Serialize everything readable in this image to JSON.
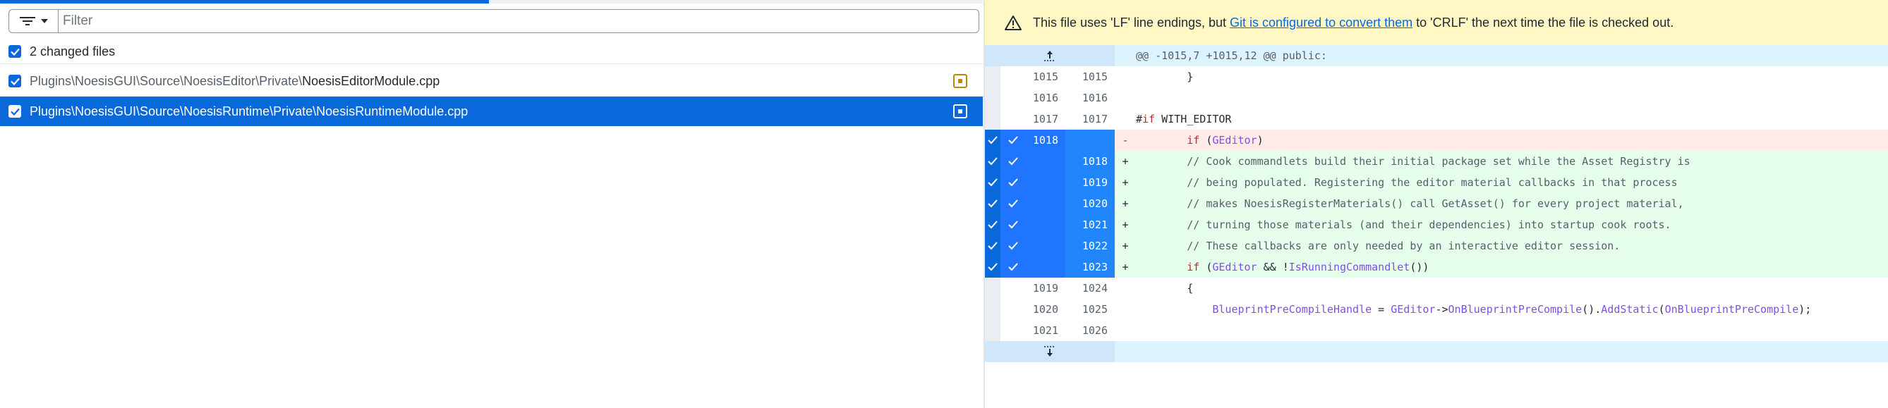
{
  "sidebar": {
    "filter": {
      "placeholder": "Filter",
      "value": ""
    },
    "changed_files_label": "2 changed files",
    "files": [
      {
        "dir": "Plugins\\NoesisGUI\\Source\\NoesisEditor\\Private\\",
        "name": "NoesisEditorModule.cpp",
        "status": "modified",
        "selected": false
      },
      {
        "dir": "Plugins\\NoesisGUI\\Source\\NoesisRuntime\\Private\\",
        "name": "NoesisRuntimeModule.cpp",
        "status": "modified",
        "selected": true
      }
    ]
  },
  "banner": {
    "text_before": "This file uses 'LF' line endings, but",
    "link_text": "Git is configured to convert them",
    "text_after": "to 'CRLF' the next time the file is checked out."
  },
  "diff": {
    "hunk_header": "@@ -1015,7 +1015,12 @@ public:",
    "lines": [
      {
        "type": "context",
        "old": "1015",
        "new": "1015",
        "sign": "",
        "code": "        }"
      },
      {
        "type": "context",
        "old": "1016",
        "new": "1016",
        "sign": "",
        "code": ""
      },
      {
        "type": "context",
        "old": "1017",
        "new": "1017",
        "sign": "",
        "code": "#if WITH_EDITOR"
      },
      {
        "type": "del",
        "old": "1018",
        "new": "",
        "sign": "-",
        "code": "        if (GEditor)"
      },
      {
        "type": "add",
        "old": "",
        "new": "1018",
        "sign": "+",
        "code": "        // Cook commandlets build their initial package set while the Asset Registry is"
      },
      {
        "type": "add",
        "old": "",
        "new": "1019",
        "sign": "+",
        "code": "        // being populated. Registering the editor material callbacks in that process"
      },
      {
        "type": "add",
        "old": "",
        "new": "1020",
        "sign": "+",
        "code": "        // makes NoesisRegisterMaterials() call GetAsset() for every project material,"
      },
      {
        "type": "add",
        "old": "",
        "new": "1021",
        "sign": "+",
        "code": "        // turning those materials (and their dependencies) into startup cook roots."
      },
      {
        "type": "add",
        "old": "",
        "new": "1022",
        "sign": "+",
        "code": "        // These callbacks are only needed by an interactive editor session."
      },
      {
        "type": "add",
        "old": "",
        "new": "1023",
        "sign": "+",
        "code": "        if (GEditor && !IsRunningCommandlet())"
      },
      {
        "type": "context",
        "old": "1019",
        "new": "1024",
        "sign": "",
        "code": "        {"
      },
      {
        "type": "context",
        "old": "1020",
        "new": "1025",
        "sign": "",
        "code": "            BlueprintPreCompileHandle = GEditor->OnBlueprintPreCompile().AddStatic(OnBlueprintPreCompile);"
      },
      {
        "type": "context",
        "old": "1021",
        "new": "1026",
        "sign": "",
        "code": ""
      }
    ]
  },
  "colors": {
    "accent": "#0969da",
    "selection_line": "#2186fc",
    "added_bg": "#e6ffec",
    "deleted_bg": "#ffebe9",
    "warning_bg": "#fff8c5",
    "modified_badge": "#bf8700"
  },
  "icons": {
    "filter": "filter-lines-icon",
    "warning": "alert-triangle-icon",
    "expand_up": "expand-up-icon",
    "expand_down": "expand-down-icon",
    "check": "check-icon",
    "modified": "file-modified-icon"
  }
}
